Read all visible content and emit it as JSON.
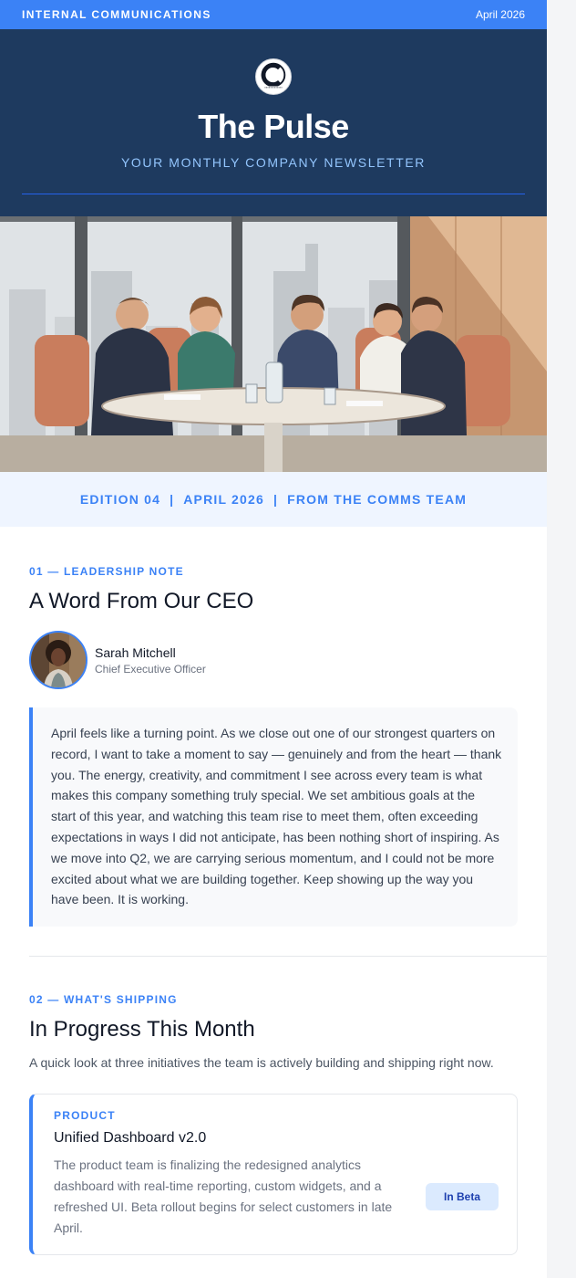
{
  "topbar": {
    "label": "INTERNAL COMMUNICATIONS",
    "date": "April 2026"
  },
  "header": {
    "title": "The Pulse",
    "subtitle": "YOUR MONTHLY COMPANY NEWSLETTER",
    "logo_text": "COMPANY LOGO"
  },
  "edition": {
    "number": "EDITION 04",
    "date": "APRIL 2026",
    "from": "FROM THE COMMS TEAM",
    "separator": "|"
  },
  "leadership": {
    "eyebrow": "01 — LEADERSHIP NOTE",
    "title": "A Word From Our CEO",
    "author_name": "Sarah Mitchell",
    "author_role": "Chief Executive Officer",
    "quote": "April feels like a turning point. As we close out one of our strongest quarters on record, I want to take a moment to say — genuinely and from the heart — thank you. The energy, creativity, and commitment I see across every team is what makes this company something truly special. We set ambitious goals at the start of this year, and watching this team rise to meet them, often exceeding expectations in ways I did not anticipate, has been nothing short of inspiring. As we move into Q2, we are carrying serious momentum, and I could not be more excited about what we are building together. Keep showing up the way you have been. It is working."
  },
  "shipping": {
    "eyebrow": "02 — WHAT'S SHIPPING",
    "title": "In Progress This Month",
    "lede": "A quick look at three initiatives the team is actively building and shipping right now.",
    "cards": [
      {
        "category": "PRODUCT",
        "name": "Unified Dashboard v2.0",
        "description": "The product team is finalizing the redesigned analytics dashboard with real-time reporting, custom widgets, and a refreshed UI. Beta rollout begins for select customers in late April.",
        "status": "In Beta"
      }
    ]
  },
  "colors": {
    "accent": "#3b82f6",
    "header_bg": "#1e3a5f",
    "edition_bg": "#eff5ff",
    "badge_bg": "#dbeafe"
  }
}
